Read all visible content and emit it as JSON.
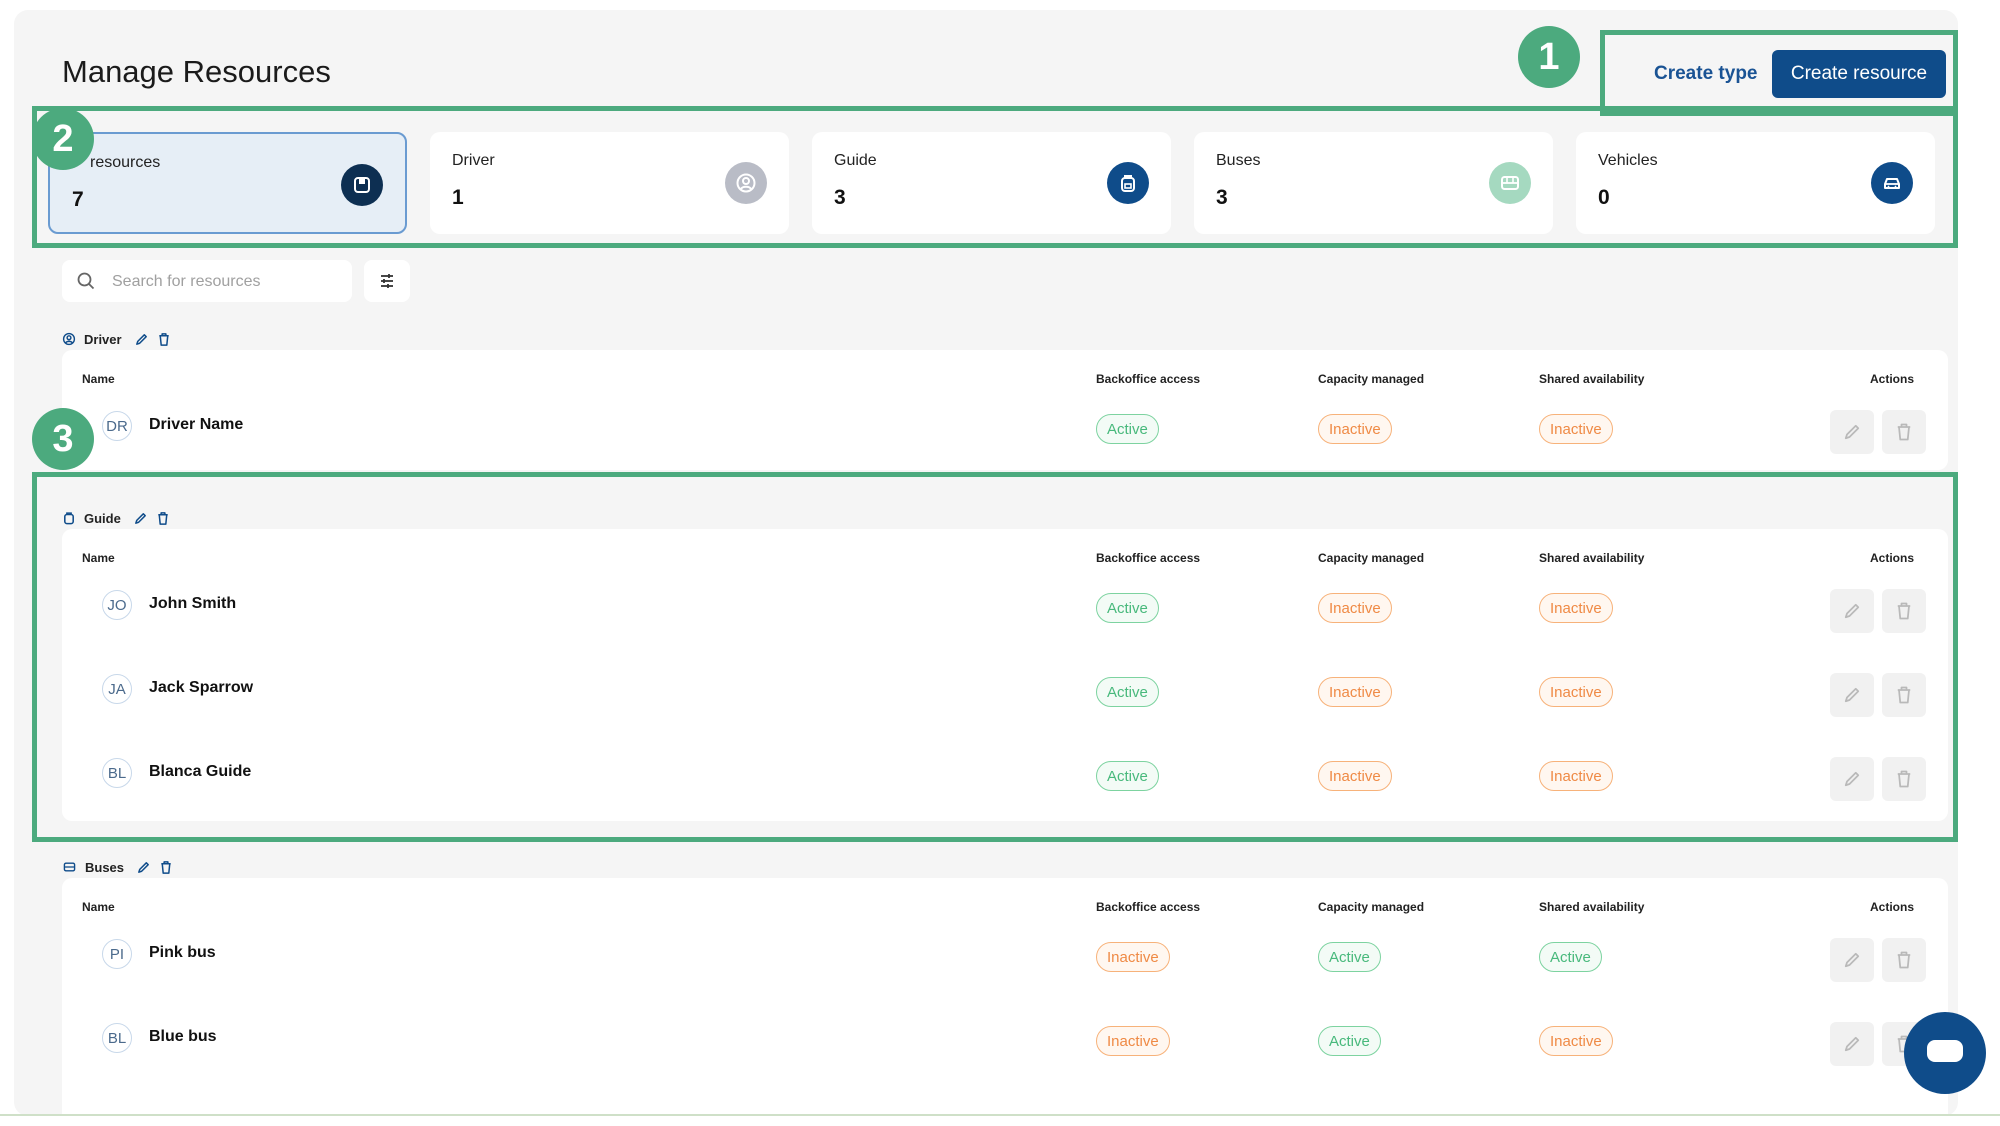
{
  "page": {
    "title": "Manage Resources"
  },
  "header": {
    "create_type": "Create type",
    "create_resource": "Create resource"
  },
  "callouts": [
    "1",
    "2",
    "3"
  ],
  "summary_cards": [
    {
      "label": "resources",
      "count": "7",
      "icon": "tag-icon",
      "selected": true
    },
    {
      "label": "Driver",
      "count": "1",
      "icon": "user-circle-icon"
    },
    {
      "label": "Guide",
      "count": "3",
      "icon": "backpack-icon"
    },
    {
      "label": "Buses",
      "count": "3",
      "icon": "bus-icon"
    },
    {
      "label": "Vehicles",
      "count": "0",
      "icon": "car-icon"
    }
  ],
  "search": {
    "placeholder": "Search for resources",
    "value": ""
  },
  "table_headers": {
    "name": "Name",
    "backoffice": "Backoffice access",
    "capacity": "Capacity managed",
    "shared": "Shared availability",
    "actions": "Actions"
  },
  "sections": [
    {
      "title": "Driver",
      "icon": "user-circle-icon",
      "rows": [
        {
          "initials": "DR",
          "name": "Driver Name",
          "backoffice": "Active",
          "capacity": "Inactive",
          "shared": "Inactive"
        }
      ]
    },
    {
      "title": "Guide",
      "icon": "backpack-icon",
      "rows": [
        {
          "initials": "JO",
          "name": "John Smith",
          "backoffice": "Active",
          "capacity": "Inactive",
          "shared": "Inactive"
        },
        {
          "initials": "JA",
          "name": "Jack Sparrow",
          "backoffice": "Active",
          "capacity": "Inactive",
          "shared": "Inactive"
        },
        {
          "initials": "BL",
          "name": "Blanca Guide",
          "backoffice": "Active",
          "capacity": "Inactive",
          "shared": "Inactive"
        }
      ]
    },
    {
      "title": "Buses",
      "icon": "bus-icon",
      "rows": [
        {
          "initials": "PI",
          "name": "Pink bus",
          "backoffice": "Inactive",
          "capacity": "Active",
          "shared": "Active"
        },
        {
          "initials": "BL",
          "name": "Blue bus",
          "backoffice": "Inactive",
          "capacity": "Active",
          "shared": "Inactive"
        }
      ]
    }
  ],
  "colors": {
    "accent": "#0f4c8a",
    "highlight": "#4caa7e",
    "active": "#48b97c",
    "inactive": "#ef8a45"
  }
}
